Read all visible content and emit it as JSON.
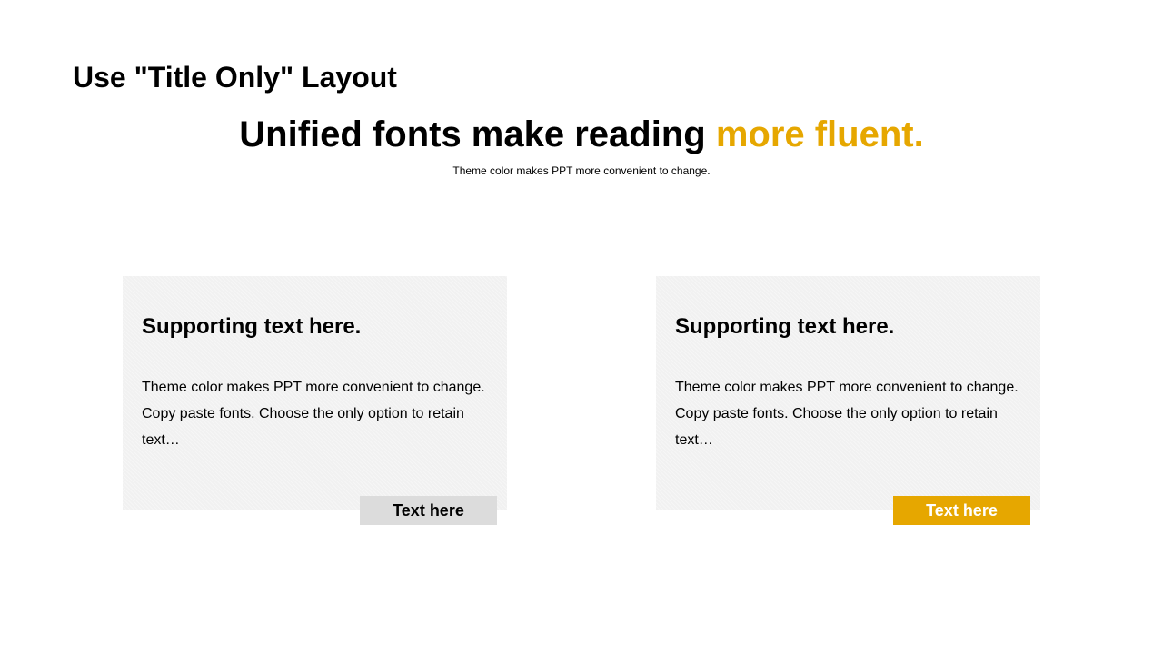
{
  "slide": {
    "title": "Use \"Title Only\" Layout",
    "headline": {
      "main": "Unified fonts make reading ",
      "accent": "more fluent."
    },
    "subtitle": "Theme color makes PPT more convenient to change."
  },
  "cards": [
    {
      "heading": "Supporting text here.",
      "body": "Theme color makes PPT more convenient to change. Copy paste fonts. Choose the only option to retain text…",
      "tag": "Text here"
    },
    {
      "heading": "Supporting text here.",
      "body": "Theme color makes PPT more convenient to change. Copy paste fonts. Choose the only option to retain text…",
      "tag": "Text here"
    }
  ],
  "colors": {
    "accent": "#E6A700",
    "card_background": "#F1F1F1",
    "tag_neutral": "#DCDCDC"
  }
}
